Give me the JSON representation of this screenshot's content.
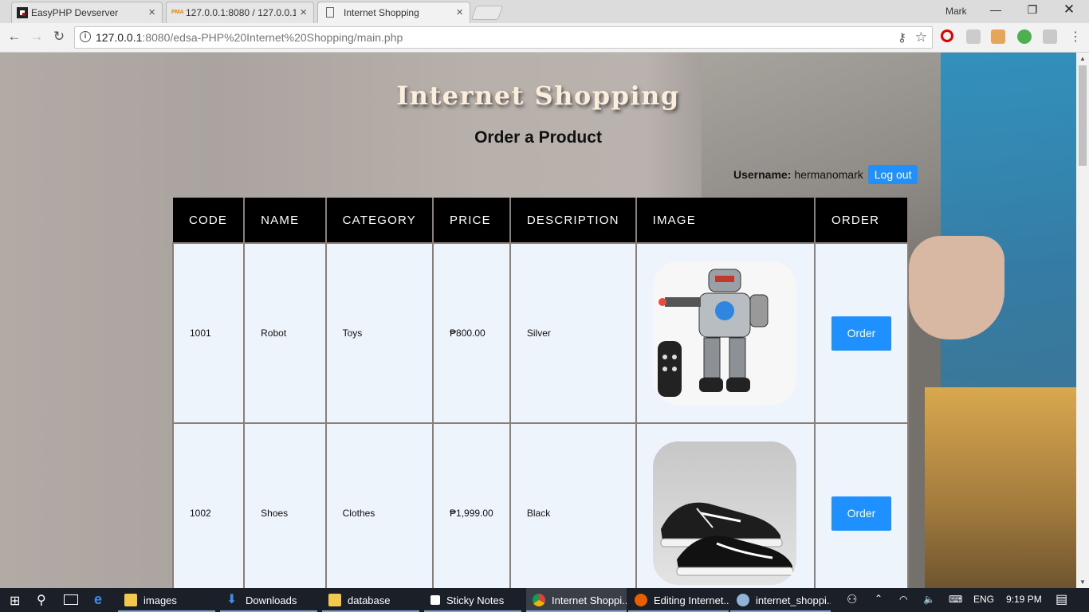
{
  "browser": {
    "tabs": [
      {
        "label": "EasyPHP Devserver"
      },
      {
        "label": "127.0.0.1:8080 / 127.0.0.1"
      },
      {
        "label": "Internet Shopping"
      }
    ],
    "window_user": "Mark",
    "url_host": "127.0.0.1",
    "url_path": ":8080/edsa-PHP%20Internet%20Shopping/main.php"
  },
  "page": {
    "site_title": "Internet Shopping",
    "heading": "Order a Product",
    "username_label": "Username:",
    "username": "hermanomark",
    "logout_label": "Log out",
    "table": {
      "headers": [
        "CODE",
        "NAME",
        "CATEGORY",
        "PRICE",
        "DESCRIPTION",
        "IMAGE",
        "ORDER"
      ],
      "rows": [
        {
          "code": "1001",
          "name": "Robot",
          "category": "Toys",
          "price": "₱800.00",
          "description": "Silver",
          "image": "robot-toy-image",
          "order_label": "Order"
        },
        {
          "code": "1002",
          "name": "Shoes",
          "category": "Clothes",
          "price": "₱1,999.00",
          "description": "Black",
          "image": "black-sneakers-image",
          "order_label": "Order"
        }
      ]
    }
  },
  "taskbar": {
    "items": [
      {
        "label": "images"
      },
      {
        "label": "Downloads"
      },
      {
        "label": "database"
      },
      {
        "label": "Sticky Notes"
      },
      {
        "label": "Internet Shoppi..."
      },
      {
        "label": "Editing Internet..."
      },
      {
        "label": "internet_shoppi..."
      }
    ],
    "language": "ENG",
    "time": "9:19 PM"
  }
}
